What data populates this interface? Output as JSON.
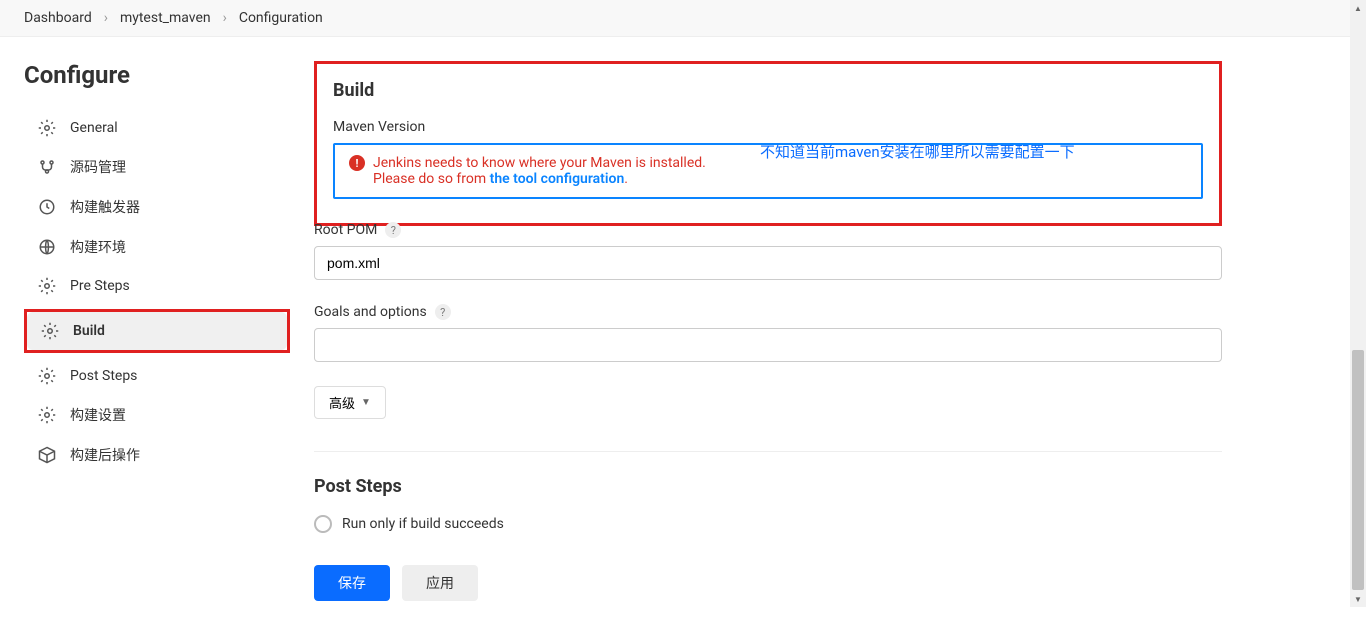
{
  "breadcrumb": {
    "items": [
      "Dashboard",
      "mytest_maven",
      "Configuration"
    ]
  },
  "sidebar": {
    "title": "Configure",
    "items": [
      {
        "label": "General"
      },
      {
        "label": "源码管理"
      },
      {
        "label": "构建触发器"
      },
      {
        "label": "构建环境"
      },
      {
        "label": "Pre Steps"
      },
      {
        "label": "Build"
      },
      {
        "label": "Post Steps"
      },
      {
        "label": "构建设置"
      },
      {
        "label": "构建后操作"
      }
    ]
  },
  "build": {
    "title": "Build",
    "maven_label": "Maven Version",
    "error_line1": "Jenkins needs to know where your Maven is installed.",
    "error_line2_prefix": "Please do so from ",
    "error_link": "the tool configuration",
    "root_pom_label": "Root POM",
    "root_pom_value": "pom.xml",
    "goals_label": "Goals and options",
    "goals_value": "",
    "advanced_label": "高级"
  },
  "post_steps": {
    "title": "Post Steps",
    "option1": "Run only if build succeeds"
  },
  "buttons": {
    "save": "保存",
    "apply": "应用"
  },
  "annotation": {
    "text": "不知道当前maven安装在哪里所以需要配置一下"
  }
}
